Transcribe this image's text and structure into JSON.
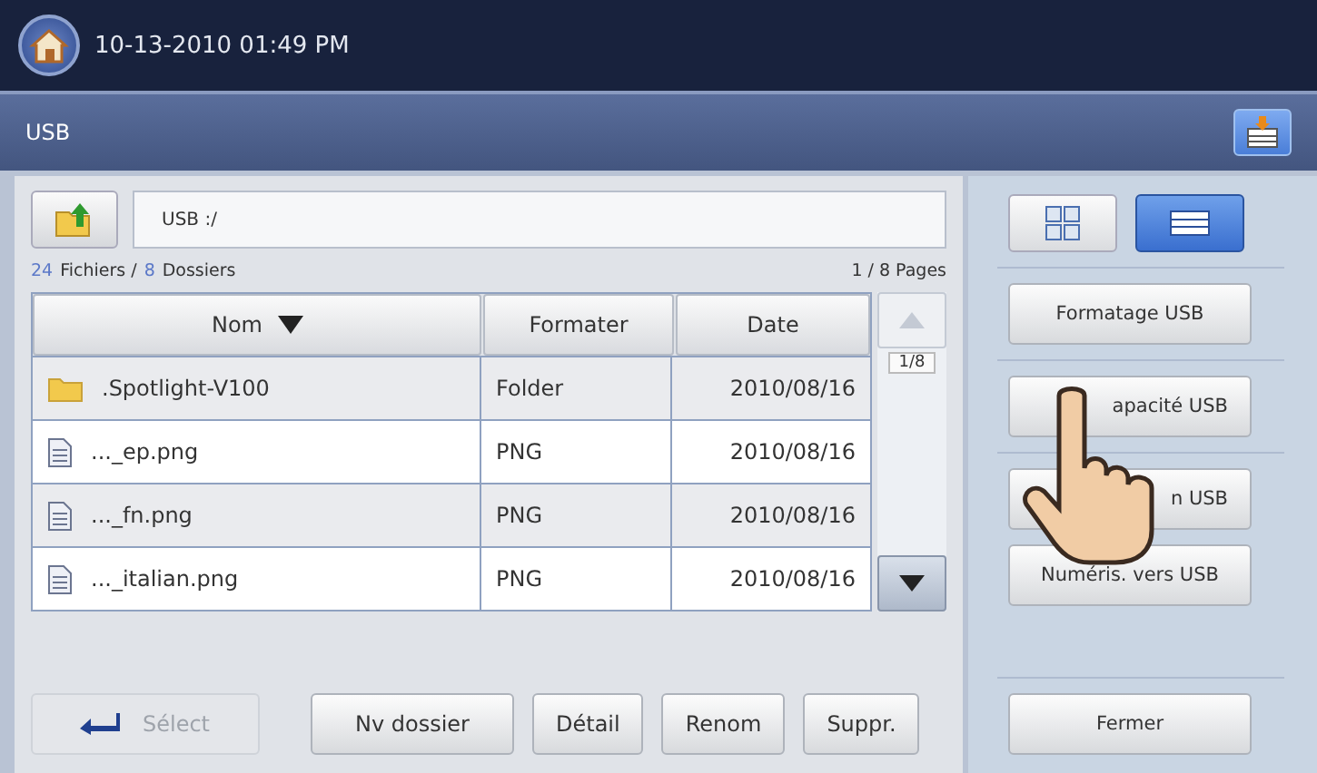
{
  "status_bar": {
    "datetime": "10-13-2010 01:49 PM"
  },
  "title_bar": {
    "title": "USB"
  },
  "path": {
    "value": "USB :/"
  },
  "summary": {
    "files_count": "24",
    "files_label": "Fichiers /",
    "folders_count": "8",
    "folders_label": "Dossiers",
    "pages": "1 / 8  Pages"
  },
  "table": {
    "columns": [
      {
        "label": "Nom",
        "sorted": true
      },
      {
        "label": "Formater",
        "sorted": false
      },
      {
        "label": "Date",
        "sorted": false
      }
    ],
    "rows": [
      {
        "kind": "folder",
        "name": ".Spotlight-V100",
        "format": "Folder",
        "date": "2010/08/16"
      },
      {
        "kind": "file",
        "name": "..._ep.png",
        "format": "PNG",
        "date": "2010/08/16"
      },
      {
        "kind": "file",
        "name": "..._fn.png",
        "format": "PNG",
        "date": "2010/08/16"
      },
      {
        "kind": "file",
        "name": "..._italian.png",
        "format": "PNG",
        "date": "2010/08/16"
      }
    ]
  },
  "scroll": {
    "page": "1/8"
  },
  "bottom_buttons": [
    {
      "kind": "select",
      "label": "Sélect",
      "disabled": true
    },
    {
      "kind": "plain",
      "label": "Nv dossier",
      "disabled": false
    },
    {
      "kind": "plain",
      "label": "Détail",
      "disabled": false
    },
    {
      "kind": "plain",
      "label": "Renom",
      "disabled": false
    },
    {
      "kind": "plain",
      "label": "Suppr.",
      "disabled": false
    }
  ],
  "view_toggles": [
    {
      "kind": "grid",
      "selected": false
    },
    {
      "kind": "list",
      "selected": true
    }
  ],
  "side_buttons": [
    {
      "kind": "full",
      "label": "Formatage USB"
    },
    {
      "kind": "partial",
      "label": "apacité USB"
    },
    {
      "kind": "partial",
      "label": "n USB"
    },
    {
      "kind": "full",
      "label": "Numéris. vers USB"
    }
  ],
  "close_button": {
    "label": "Fermer"
  }
}
